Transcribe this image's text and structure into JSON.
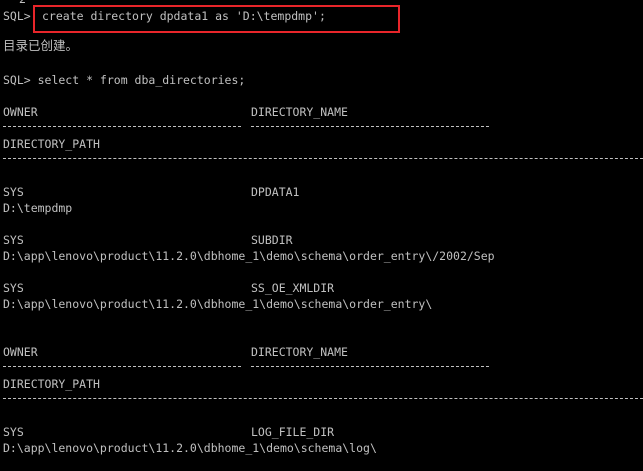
{
  "console": {
    "prev_line_no": "2",
    "cmd1_prompt": "SQL>",
    "cmd1_text": "create directory dpdata1 as 'D:\\tempdmp';",
    "cmd1_result": "目录已创建。",
    "cmd2": "SQL> select * from dba_directories;",
    "col_owner": "OWNER",
    "col_directory_name": "DIRECTORY_NAME",
    "col_directory_path": "DIRECTORY_PATH",
    "rows": [
      {
        "owner": "SYS",
        "name": "DPDATA1",
        "path": "D:\\tempdmp"
      },
      {
        "owner": "SYS",
        "name": "SUBDIR",
        "path": "D:\\app\\lenovo\\product\\11.2.0\\dbhome_1\\demo\\schema\\order_entry\\/2002/Sep"
      },
      {
        "owner": "SYS",
        "name": "SS_OE_XMLDIR",
        "path": "D:\\app\\lenovo\\product\\11.2.0\\dbhome_1\\demo\\schema\\order_entry\\"
      },
      {
        "owner": "SYS",
        "name": "LOG_FILE_DIR",
        "path": "D:\\app\\lenovo\\product\\11.2.0\\dbhome_1\\demo\\schema\\log\\"
      }
    ],
    "highlight_color": "#e8252a",
    "text_color": "#c0c0c0",
    "background_color": "#000000"
  }
}
